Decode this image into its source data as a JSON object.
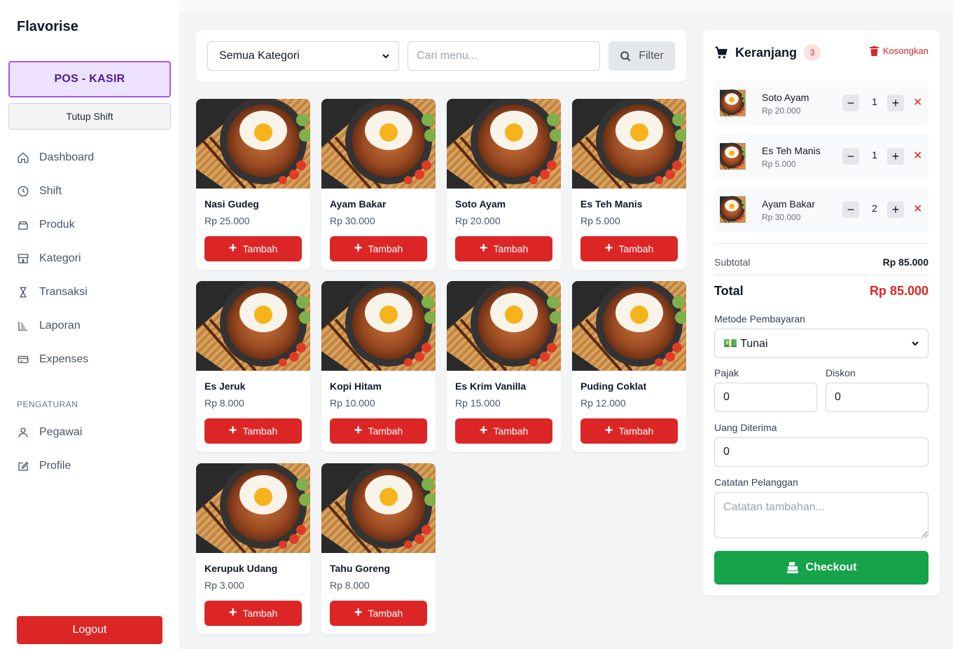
{
  "sidebar": {
    "brand": "Flavorise",
    "pos_label": "POS - KASIR",
    "shift_label": "Tutup Shift",
    "nav": [
      {
        "label": "Dashboard",
        "icon": "home-icon"
      },
      {
        "label": "Shift",
        "icon": "clock-icon"
      },
      {
        "label": "Produk",
        "icon": "box-icon"
      },
      {
        "label": "Kategori",
        "icon": "store-icon"
      },
      {
        "label": "Transaksi",
        "icon": "hourglass-icon"
      },
      {
        "label": "Laporan",
        "icon": "chart-icon"
      },
      {
        "label": "Expenses",
        "icon": "card-icon"
      }
    ],
    "section_label": "PENGATURAN",
    "settings": [
      {
        "label": "Pegawai",
        "icon": "user-icon"
      },
      {
        "label": "Profile",
        "icon": "edit-icon"
      }
    ],
    "logout_label": "Logout"
  },
  "filter": {
    "category_value": "Semua Kategori",
    "search_placeholder": "Cari menu...",
    "button_label": "Filter"
  },
  "add_label": "Tambah",
  "products": [
    {
      "name": "Nasi Gudeg",
      "price": "Rp 25.000"
    },
    {
      "name": "Ayam Bakar",
      "price": "Rp 30.000"
    },
    {
      "name": "Soto Ayam",
      "price": "Rp 20.000"
    },
    {
      "name": "Es Teh Manis",
      "price": "Rp 5.000"
    },
    {
      "name": "Es Jeruk",
      "price": "Rp 8.000"
    },
    {
      "name": "Kopi Hitam",
      "price": "Rp 10.000"
    },
    {
      "name": "Es Krim Vanilla",
      "price": "Rp 15.000"
    },
    {
      "name": "Puding Coklat",
      "price": "Rp 12.000"
    },
    {
      "name": "Kerupuk Udang",
      "price": "Rp 3.000"
    },
    {
      "name": "Tahu Goreng",
      "price": "Rp 8.000"
    }
  ],
  "cart": {
    "title": "Keranjang",
    "count": "3",
    "clear_label": "Kosongkan",
    "items": [
      {
        "name": "Soto Ayam",
        "price": "Rp 20.000",
        "qty": "1"
      },
      {
        "name": "Es Teh Manis",
        "price": "Rp 5.000",
        "qty": "1"
      },
      {
        "name": "Ayam Bakar",
        "price": "Rp 30.000",
        "qty": "2"
      }
    ],
    "subtotal_label": "Subtotal",
    "subtotal_value": "Rp 85.000",
    "total_label": "Total",
    "total_value": "Rp 85.000",
    "payment_label": "Metode Pembayaran",
    "payment_value": "💵 Tunai",
    "tax_label": "Pajak",
    "tax_value": "0",
    "discount_label": "Diskon",
    "discount_value": "0",
    "received_label": "Uang Diterima",
    "received_value": "0",
    "notes_label": "Catatan Pelanggan",
    "notes_placeholder": "Catatan tambahan...",
    "checkout_label": "Checkout"
  },
  "colors": {
    "primary_red": "#dc2626",
    "checkout_green": "#16a34a",
    "pos_purple": "#a855f7"
  }
}
